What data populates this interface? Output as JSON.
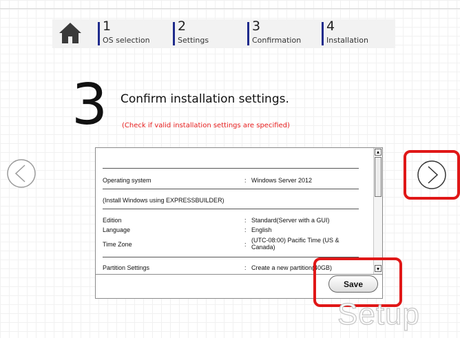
{
  "steps": [
    {
      "num": "1",
      "label": "OS selection"
    },
    {
      "num": "2",
      "label": "Settings"
    },
    {
      "num": "3",
      "label": "Confirmation"
    },
    {
      "num": "4",
      "label": "Installation"
    }
  ],
  "header": {
    "step_number": "3",
    "title": "Confirm installation settings.",
    "subtitle": "(Check if valid installation settings are specified)"
  },
  "summary": {
    "os_label": "Operating system",
    "os_value": "Windows Server 2012",
    "install_note": "(Install Windows using EXPRESSBUILDER)",
    "edition_label": "Edition",
    "edition_value": "Standard(Server with a GUI)",
    "language_label": "Language",
    "language_value": "English",
    "timezone_label": "Time Zone",
    "timezone_value_1": "(UTC-08:00) Pacific Time (US &",
    "timezone_value_2": "Canada)",
    "partition_label": "Partition Settings",
    "partition_value": "Create a new partition(40GB)",
    "colon": ":"
  },
  "buttons": {
    "save": "Save"
  },
  "watermark": "Setup",
  "colors": {
    "accent_bar": "#1e2a8c",
    "highlight": "#e01717",
    "subtitle": "#e82020"
  }
}
